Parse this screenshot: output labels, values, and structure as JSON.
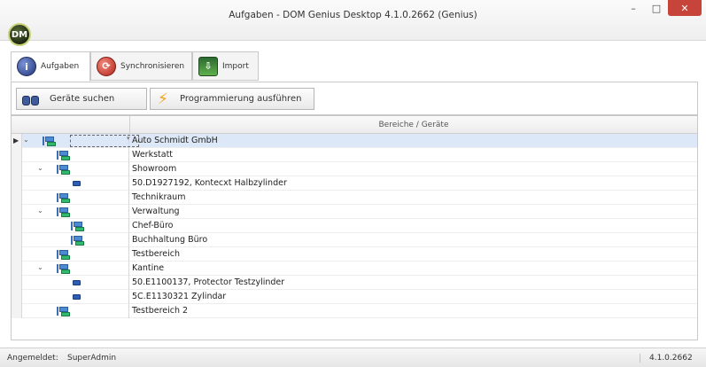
{
  "app": {
    "logo_text": "DM",
    "title": "Aufgaben - DOM Genius Desktop 4.1.0.2662 (Genius)",
    "window_buttons": {
      "minimize": "–",
      "maximize": "□",
      "close": "✕"
    }
  },
  "tabs": [
    {
      "label": "Aufgaben",
      "icon": "info-icon",
      "active": true
    },
    {
      "label": "Synchronisieren",
      "icon": "sync-icon",
      "active": false
    },
    {
      "label": "Import",
      "icon": "import-icon",
      "active": false
    }
  ],
  "toolbar": {
    "search_label": "Geräte suchen",
    "program_label": "Programmierung ausführen"
  },
  "grid": {
    "column_header": "Bereiche / Geräte",
    "rows": [
      {
        "name": "Auto Schmidt GmbH",
        "type": "area",
        "level": 0,
        "expanded": true,
        "selected": true
      },
      {
        "name": "Werkstatt",
        "type": "area",
        "level": 1,
        "expanded": false
      },
      {
        "name": "Showroom",
        "type": "area",
        "level": 1,
        "expanded": true
      },
      {
        "name": "50.D1927192, Kontecxt Halbzylinder",
        "type": "device",
        "level": 2
      },
      {
        "name": "Technikraum",
        "type": "area",
        "level": 1,
        "expanded": false
      },
      {
        "name": "Verwaltung",
        "type": "area",
        "level": 1,
        "expanded": true
      },
      {
        "name": "Chef-Büro",
        "type": "area",
        "level": 2,
        "expanded": false
      },
      {
        "name": "Buchhaltung Büro",
        "type": "area",
        "level": 2,
        "expanded": false
      },
      {
        "name": "Testbereich",
        "type": "area",
        "level": 1,
        "expanded": false
      },
      {
        "name": "Kantine",
        "type": "area",
        "level": 1,
        "expanded": true
      },
      {
        "name": "50.E1100137, Protector Testzylinder",
        "type": "device",
        "level": 2
      },
      {
        "name": "5C.E1130321 Zylindar",
        "type": "device",
        "level": 2
      },
      {
        "name": "Testbereich 2",
        "type": "area",
        "level": 1,
        "expanded": false
      }
    ]
  },
  "status": {
    "label": "Angemeldet:",
    "user": "SuperAdmin",
    "version": "4.1.0.2662"
  },
  "colors": {
    "close_button": "#c7443b",
    "selected_row": "#dce8f7",
    "bolt": "#f3a11a"
  }
}
